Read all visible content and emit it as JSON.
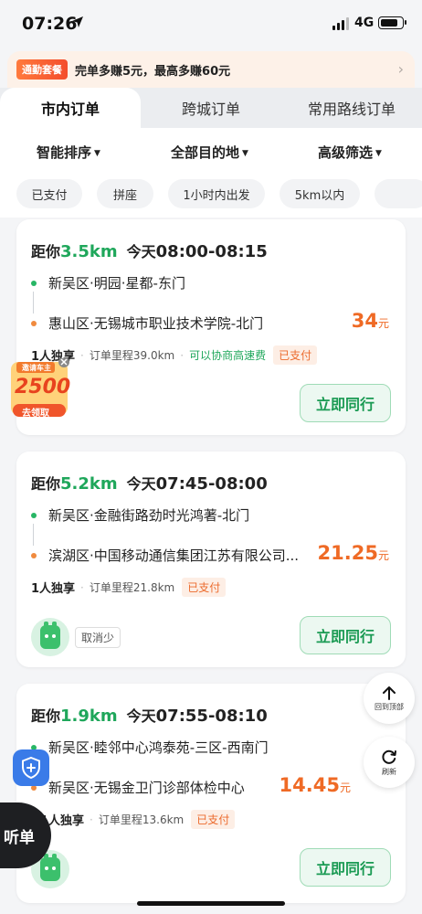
{
  "status": {
    "time": "07:26",
    "network": "4G",
    "battery_level": 0.85
  },
  "promo": {
    "tag": "通勤套餐",
    "text": "完单多赚5元，最高多赚60元"
  },
  "tabs": [
    "市内订单",
    "跨城订单",
    "常用路线订单"
  ],
  "active_tab": 0,
  "filters": [
    "智能排序",
    "全部目的地",
    "高级筛选"
  ],
  "chips": [
    "已支付",
    "拼座",
    "1小时内出发",
    "5km以内",
    ""
  ],
  "orders": [
    {
      "dist_prefix": "距你",
      "dist_value": "3.5km",
      "day": "今天",
      "time": "08:00-08:15",
      "from": "新吴区·明园·星都-东门",
      "to": "惠山区·无锡城市职业技术学院-北门",
      "price": "34",
      "price_unit": "元",
      "seat": "1人独享",
      "mileage": "订单里程39.0km",
      "extra": "可以协商高速费",
      "paid": "已支付",
      "button": "立即同行"
    },
    {
      "dist_prefix": "距你",
      "dist_value": "5.2km",
      "day": "今天",
      "time": "07:45-08:00",
      "from": "新吴区·金融街路劲时光鸿著-北门",
      "to": "滨湖区·中国移动通信集团江苏有限公司...",
      "price": "21.25",
      "price_unit": "元",
      "seat": "1人独享",
      "mileage": "订单里程21.8km",
      "paid": "已支付",
      "less_label": "取消少",
      "button": "立即同行"
    },
    {
      "dist_prefix": "距你",
      "dist_value": "1.9km",
      "day": "今天",
      "time": "07:55-08:10",
      "from": "新吴区·睦邻中心鸿泰苑-三区-西南门",
      "to": "新吴区·无锡金卫门诊部体检中心",
      "price": "14.45",
      "price_unit": "元",
      "seat": "1人独享",
      "mileage": "订单里程13.6km",
      "paid": "已支付",
      "button": "立即同行"
    }
  ],
  "recruit": {
    "top": "邀请车主",
    "amount": "2500",
    "cta": "去领取"
  },
  "floating": {
    "back_top": "回到顶部",
    "refresh": "刷新",
    "listen": "听单"
  },
  "colors": {
    "green": "#1fa75b",
    "orange": "#ef6a25",
    "bg": "#f4f5f7"
  },
  "icons": [
    "location-arrow-icon",
    "signal-icon",
    "battery-icon",
    "chevron-right-icon",
    "caret-down-icon",
    "arrow-up-icon",
    "refresh-icon",
    "shield-plus-icon",
    "close-icon"
  ]
}
